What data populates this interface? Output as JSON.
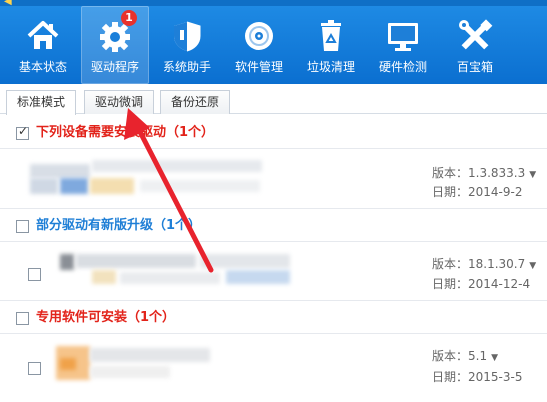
{
  "toolbar": {
    "items": [
      {
        "label": "基本状态",
        "icon": "house-icon"
      },
      {
        "label": "驱动程序",
        "icon": "gear-icon",
        "badge": "1"
      },
      {
        "label": "系统助手",
        "icon": "shield-icon"
      },
      {
        "label": "软件管理",
        "icon": "disc-icon"
      },
      {
        "label": "垃圾清理",
        "icon": "recycle-bin-icon"
      },
      {
        "label": "硬件检测",
        "icon": "monitor-icon"
      },
      {
        "label": "百宝箱",
        "icon": "tools-icon"
      }
    ]
  },
  "tabs": [
    "标准模式",
    "驱动微调",
    "备份还原"
  ],
  "sections": [
    {
      "title": "下列设备需要安装驱动（1个）",
      "checked": true,
      "version": "版本：1.3.833.3",
      "date": "日期：2014-9-2"
    },
    {
      "title": "部分驱动有新版升级（1个）",
      "checked": false,
      "version": "版本：18.1.30.7",
      "date": "日期：2014-12-4"
    },
    {
      "title": "专用软件可安装（1个）",
      "checked": false,
      "version": "版本：5.1",
      "date": "日期：2015-3-5"
    }
  ],
  "colors": {
    "toolbar_top": "#1e8ae4",
    "toolbar_bottom": "#0b6fd0",
    "red_heading": "#e2231a",
    "blue_heading": "#1f7fd6",
    "badge": "#e8322c",
    "annotation_arrow": "#e8232d"
  }
}
